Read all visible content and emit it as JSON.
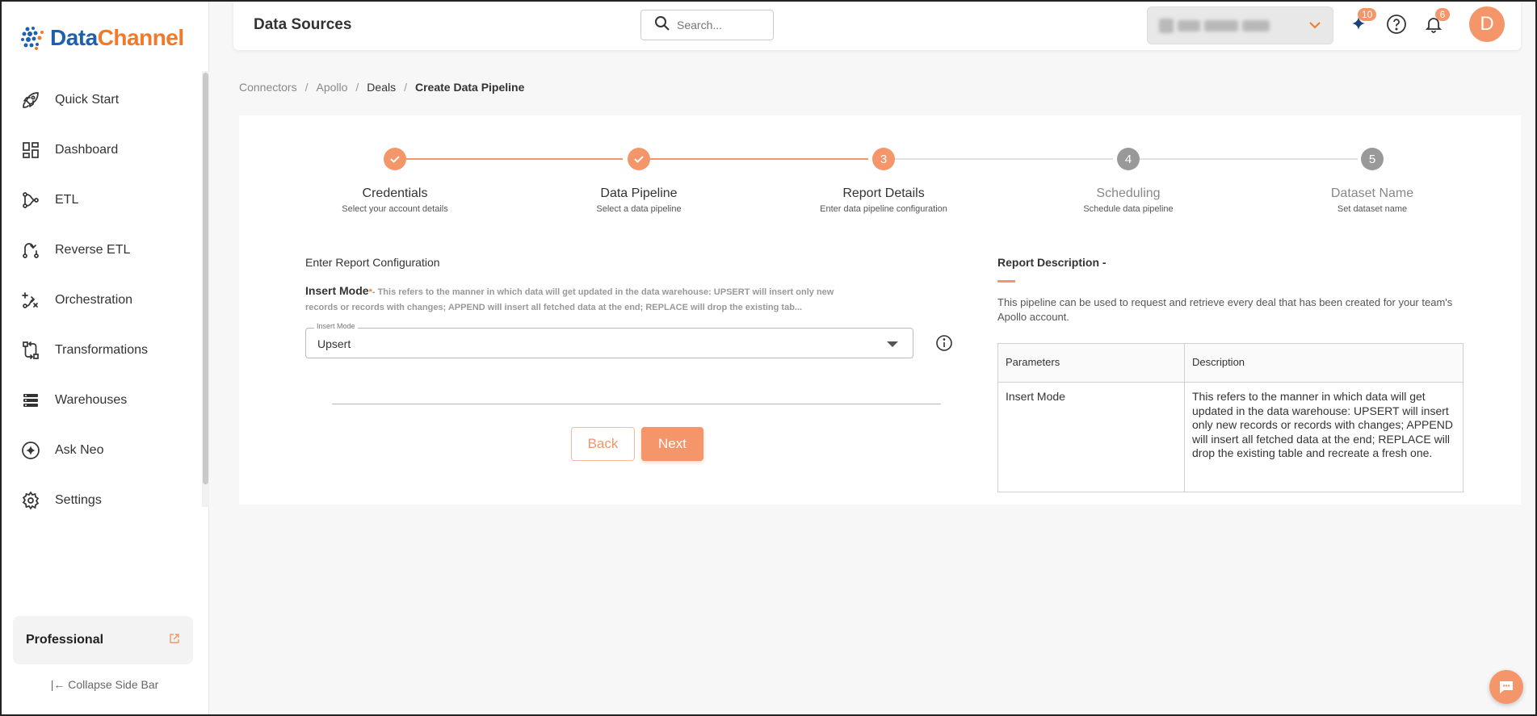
{
  "brand": {
    "name_part1": "Data",
    "name_part2": "Channel",
    "accent": "#f4956a"
  },
  "sidebar": {
    "items": [
      {
        "label": "Quick Start",
        "icon": "rocket-icon"
      },
      {
        "label": "Dashboard",
        "icon": "dashboard-icon"
      },
      {
        "label": "ETL",
        "icon": "etl-icon"
      },
      {
        "label": "Reverse ETL",
        "icon": "reverse-etl-icon"
      },
      {
        "label": "Orchestration",
        "icon": "orchestration-icon"
      },
      {
        "label": "Transformations",
        "icon": "transformations-icon"
      },
      {
        "label": "Warehouses",
        "icon": "warehouses-icon"
      },
      {
        "label": "Ask Neo",
        "icon": "sparkle-icon"
      },
      {
        "label": "Settings",
        "icon": "gear-icon"
      }
    ],
    "plan": "Professional",
    "collapse_label": "Collapse Side Bar"
  },
  "header": {
    "title": "Data Sources",
    "search_placeholder": "Search...",
    "neo_badge": "10",
    "notifications_badge": "6",
    "avatar_initial": "D"
  },
  "breadcrumb": [
    "Connectors",
    "Apollo",
    "Deals",
    "Create Data Pipeline"
  ],
  "stepper": [
    {
      "title": "Credentials",
      "subtitle": "Select your account details",
      "status": "done",
      "num": "1"
    },
    {
      "title": "Data Pipeline",
      "subtitle": "Select a data pipeline",
      "status": "done",
      "num": "2"
    },
    {
      "title": "Report Details",
      "subtitle": "Enter data pipeline configuration",
      "status": "active",
      "num": "3"
    },
    {
      "title": "Scheduling",
      "subtitle": "Schedule data pipeline",
      "status": "pending",
      "num": "4"
    },
    {
      "title": "Dataset Name",
      "subtitle": "Set dataset name",
      "status": "pending",
      "num": "5"
    }
  ],
  "form": {
    "section_title": "Enter Report Configuration",
    "insert_mode_label": "Insert Mode",
    "required_mark": "*",
    "insert_mode_help": "- This refers to the manner in which data will get updated in the data warehouse: UPSERT will insert only new records or records with changes; APPEND will insert all fetched data at the end; REPLACE will drop the existing tab...",
    "select_float_label": "Insert Mode",
    "select_value": "Upsert",
    "back_label": "Back",
    "next_label": "Next"
  },
  "description": {
    "title": "Report Description -",
    "text": "This pipeline can be used to request and retrieve every deal that has been created for your team's Apollo account.",
    "table": {
      "headers": [
        "Parameters",
        "Description"
      ],
      "rows": [
        [
          "Insert Mode",
          "This refers to the manner in which data will get updated in the data warehouse: UPSERT will insert only new records or records with changes; APPEND will insert all fetched data at the end; REPLACE will drop the existing table and recreate a fresh one."
        ]
      ]
    }
  }
}
